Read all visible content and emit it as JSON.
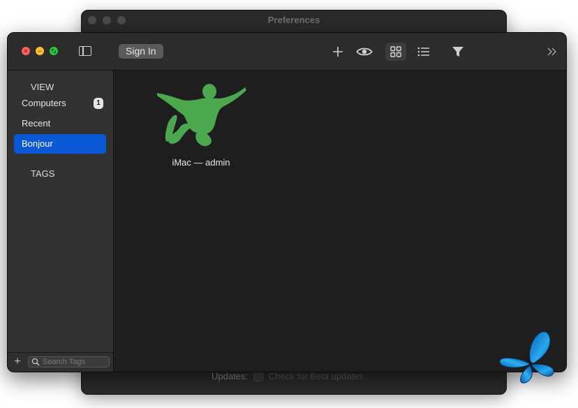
{
  "background_window": {
    "title": "Preferences",
    "updates_label": "Updates:",
    "beta_checkbox_label": "Check for Beta updates"
  },
  "toolbar": {
    "sign_in_label": "Sign In",
    "icons": [
      "sidebar-toggle-icon",
      "plus-icon",
      "eye-icon",
      "grid-icon",
      "list-icon",
      "filter-icon",
      "chevron-double-right-icon"
    ],
    "selected_view": "grid"
  },
  "sidebar": {
    "view_header": "VIEW",
    "items": [
      {
        "label": "Computers",
        "badge": "1"
      },
      {
        "label": "Recent"
      },
      {
        "label": "Bonjour",
        "selected": true
      }
    ],
    "tags_header": "TAGS",
    "search_placeholder": "Search Tags",
    "add_label": "+"
  },
  "content": {
    "computers": [
      {
        "label": "iMac — admin"
      }
    ]
  },
  "colors": {
    "selection": "#0a58d6",
    "computer_icon": "#4ca84f",
    "window_bg": "#1e1e1e",
    "sidebar_bg": "#323232"
  }
}
